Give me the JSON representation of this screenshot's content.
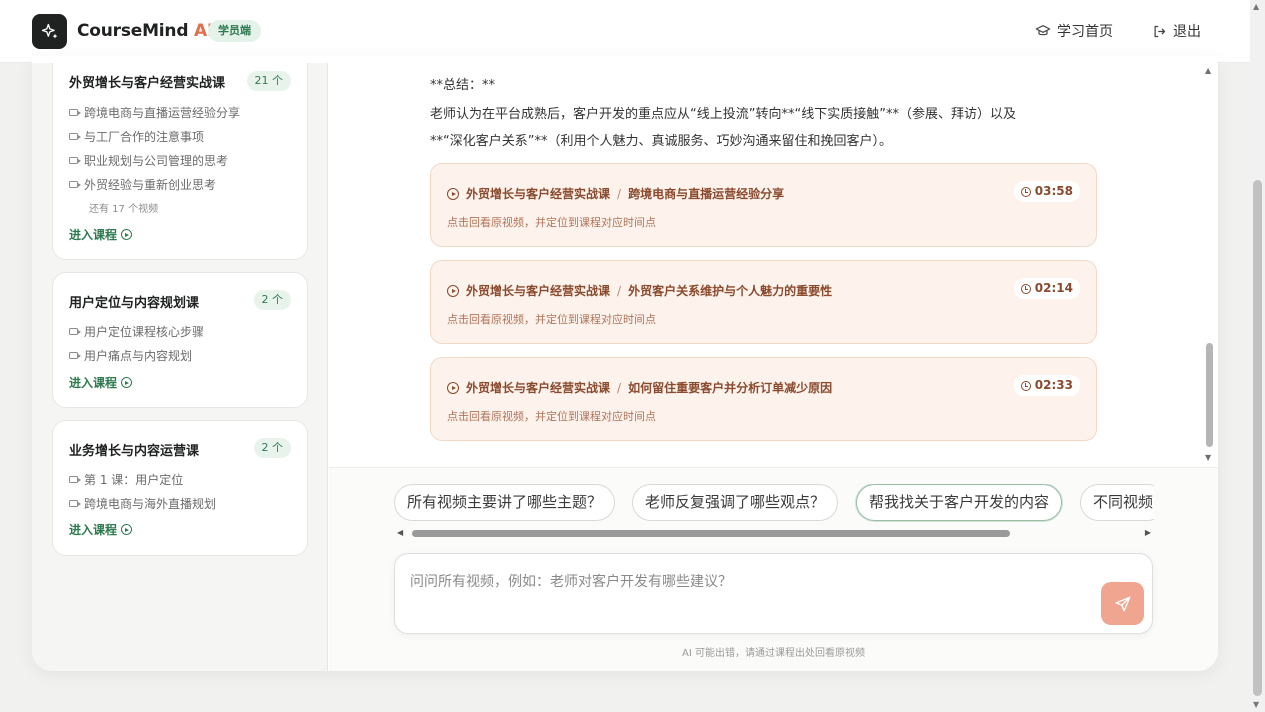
{
  "app": {
    "brand_prefix": "CourseMind",
    "brand_suffix": "AI",
    "role_badge": "学员端"
  },
  "nav": {
    "home_label": "学习首页",
    "logout_label": "退出"
  },
  "sidebar": {
    "courses": [
      {
        "title": "外贸增长与客户经营实战课",
        "count": "21 个",
        "videos": [
          "跨境电商与直播运营经验分享",
          "与工厂合作的注意事项",
          "职业规划与公司管理的思考",
          "外贸经验与重新创业思考"
        ],
        "more": "还有 17 个视频",
        "enter": "进入课程"
      },
      {
        "title": "用户定位与内容规划课",
        "count": "2 个",
        "videos": [
          "用户定位课程核心步骤",
          "用户痛点与内容规划"
        ],
        "enter": "进入课程"
      },
      {
        "title": "业务增长与内容运营课",
        "count": "2 个",
        "videos": [
          "第 1 课：用户定位",
          "跨境电商与海外直播规划"
        ],
        "enter": "进入课程"
      }
    ]
  },
  "chat": {
    "summary_heading": "**总结：**",
    "summary_line1": "老师认为在平台成熟后，客户开发的重点应从“线上投流”转向**“线下实质接触”**（参展、拜访）以及",
    "summary_line2": "**“深化客户关系”**（利用个人魅力、真诚服务、巧妙沟通来留住和挽回客户）。",
    "references": [
      {
        "course": "外贸增长与客户经营实战课",
        "sep": "/",
        "video": "跨境电商与直播运营经验分享",
        "time": "03:58",
        "hint": "点击回看原视频，并定位到课程对应时间点"
      },
      {
        "course": "外贸增长与客户经营实战课",
        "sep": "/",
        "video": "外贸客户关系维护与个人魅力的重要性",
        "time": "02:14",
        "hint": "点击回看原视频，并定位到课程对应时间点"
      },
      {
        "course": "外贸增长与客户经营实战课",
        "sep": "/",
        "video": "如何留住重要客户并分析订单减少原因",
        "time": "02:33",
        "hint": "点击回看原视频，并定位到课程对应时间点"
      }
    ]
  },
  "suggestions": [
    "所有视频主要讲了哪些主题？",
    "老师反复强调了哪些观点？",
    "帮我找关于客户开发的内容",
    "不同视频"
  ],
  "composer": {
    "placeholder": "问问所有视频，例如：老师对客户开发有哪些建议？",
    "value": "",
    "disclaimer": "AI 可能出错，请通过课程出处回看原视频"
  },
  "colors": {
    "accent_green": "#2e7a4f",
    "accent_orange": "#e06f4f",
    "reference_bg": "#fdf3ec",
    "send_button": "#efa58f"
  },
  "icons": {
    "logo": "sparkle-icon",
    "home": "graduation-cap-icon",
    "logout": "logout-icon",
    "video": "video-icon",
    "enter": "play-circle-icon",
    "reference": "play-circle-icon",
    "time": "clock-icon",
    "send": "send-icon"
  }
}
